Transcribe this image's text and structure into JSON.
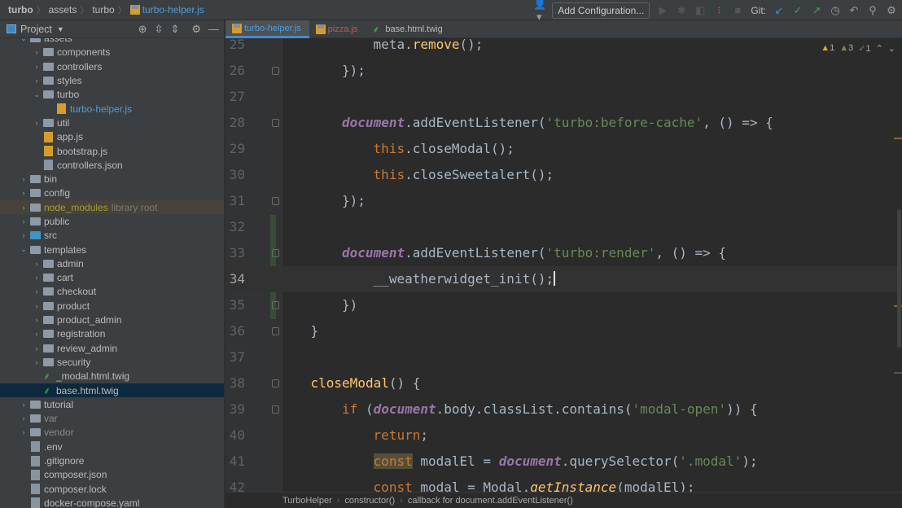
{
  "breadcrumb": [
    "turbo",
    "assets",
    "turbo",
    "turbo-helper.js"
  ],
  "toolbar": {
    "add_configuration": "Add Configuration...",
    "git_label": "Git:"
  },
  "sidebar": {
    "title": "Project",
    "items": [
      {
        "label": "assets",
        "depth": 1,
        "type": "folder",
        "expanded": true
      },
      {
        "label": "components",
        "depth": 2,
        "type": "folder"
      },
      {
        "label": "controllers",
        "depth": 2,
        "type": "folder"
      },
      {
        "label": "styles",
        "depth": 2,
        "type": "folder"
      },
      {
        "label": "turbo",
        "depth": 2,
        "type": "folder",
        "expanded": true
      },
      {
        "label": "turbo-helper.js",
        "depth": 3,
        "type": "js",
        "color": "#4a9ee0"
      },
      {
        "label": "util",
        "depth": 2,
        "type": "folder"
      },
      {
        "label": "app.js",
        "depth": 2,
        "type": "js"
      },
      {
        "label": "bootstrap.js",
        "depth": 2,
        "type": "js"
      },
      {
        "label": "controllers.json",
        "depth": 2,
        "type": "json"
      },
      {
        "label": "bin",
        "depth": 1,
        "type": "folder"
      },
      {
        "label": "config",
        "depth": 1,
        "type": "folder"
      },
      {
        "label": "node_modules",
        "depth": 1,
        "type": "folder",
        "color": "#a2a22e",
        "note": "library root",
        "highlight": true
      },
      {
        "label": "public",
        "depth": 1,
        "type": "folder"
      },
      {
        "label": "src",
        "depth": 1,
        "type": "folder",
        "blue": true
      },
      {
        "label": "templates",
        "depth": 1,
        "type": "folder",
        "expanded": true
      },
      {
        "label": "admin",
        "depth": 2,
        "type": "folder"
      },
      {
        "label": "cart",
        "depth": 2,
        "type": "folder"
      },
      {
        "label": "checkout",
        "depth": 2,
        "type": "folder"
      },
      {
        "label": "product",
        "depth": 2,
        "type": "folder"
      },
      {
        "label": "product_admin",
        "depth": 2,
        "type": "folder"
      },
      {
        "label": "registration",
        "depth": 2,
        "type": "folder"
      },
      {
        "label": "review_admin",
        "depth": 2,
        "type": "folder"
      },
      {
        "label": "security",
        "depth": 2,
        "type": "folder"
      },
      {
        "label": "_modal.html.twig",
        "depth": 2,
        "type": "twig"
      },
      {
        "label": "base.html.twig",
        "depth": 2,
        "type": "twig",
        "selected": true
      },
      {
        "label": "tutorial",
        "depth": 1,
        "type": "folder"
      },
      {
        "label": "var",
        "depth": 1,
        "type": "folder",
        "color": "#8a8a8a"
      },
      {
        "label": "vendor",
        "depth": 1,
        "type": "folder",
        "color": "#8a8a8a"
      },
      {
        "label": ".env",
        "depth": 1,
        "type": "json"
      },
      {
        "label": ".gitignore",
        "depth": 1,
        "type": "json"
      },
      {
        "label": "composer.json",
        "depth": 1,
        "type": "json"
      },
      {
        "label": "composer.lock",
        "depth": 1,
        "type": "json"
      },
      {
        "label": "docker-compose.yaml",
        "depth": 1,
        "type": "json"
      }
    ]
  },
  "tabs": [
    {
      "label": "turbo-helper.js",
      "icon": "js",
      "active": true
    },
    {
      "label": "pizza.js",
      "icon": "js",
      "color": "#c75450"
    },
    {
      "label": "base.html.twig",
      "icon": "twig"
    }
  ],
  "inspections": {
    "warnings": "1",
    "weak_warnings": "3",
    "typos": "1"
  },
  "code": [
    {
      "n": "25",
      "indent": 8,
      "t": [
        [
          "plain",
          "meta."
        ],
        [
          "fn",
          "remove"
        ],
        [
          "plain",
          "();"
        ]
      ]
    },
    {
      "n": "26",
      "indent": 4,
      "fold": true,
      "t": [
        [
          "plain",
          "});"
        ]
      ]
    },
    {
      "n": "27",
      "indent": 0,
      "t": []
    },
    {
      "n": "28",
      "indent": 4,
      "fold": true,
      "t": [
        [
          "doc",
          "document"
        ],
        [
          "plain",
          ".addEventListener("
        ],
        [
          "str",
          "'turbo:before-cache'"
        ],
        [
          "plain",
          ", () => {"
        ]
      ]
    },
    {
      "n": "29",
      "indent": 8,
      "t": [
        [
          "kw",
          "this"
        ],
        [
          "plain",
          ".closeModal();"
        ]
      ]
    },
    {
      "n": "30",
      "indent": 8,
      "t": [
        [
          "kw",
          "this"
        ],
        [
          "plain",
          ".closeSweetalert();"
        ]
      ]
    },
    {
      "n": "31",
      "indent": 4,
      "fold": true,
      "t": [
        [
          "plain",
          "});"
        ]
      ]
    },
    {
      "n": "32",
      "indent": 0,
      "t": []
    },
    {
      "n": "33",
      "indent": 4,
      "fold": true,
      "t": [
        [
          "doc",
          "document"
        ],
        [
          "plain",
          ".addEventListener("
        ],
        [
          "str",
          "'turbo:render'"
        ],
        [
          "plain",
          ", () => {"
        ]
      ]
    },
    {
      "n": "34",
      "indent": 8,
      "current": true,
      "t": [
        [
          "plain",
          "__weatherwidget_init();"
        ]
      ]
    },
    {
      "n": "35",
      "indent": 4,
      "fold": true,
      "t": [
        [
          "plain",
          "})"
        ]
      ]
    },
    {
      "n": "36",
      "indent": 0,
      "fold": true,
      "t": [
        [
          "plain",
          "}"
        ]
      ]
    },
    {
      "n": "37",
      "indent": 0,
      "t": []
    },
    {
      "n": "38",
      "indent": 0,
      "fold": true,
      "t": [
        [
          "fn",
          "closeModal"
        ],
        [
          "plain",
          "() {"
        ]
      ]
    },
    {
      "n": "39",
      "indent": 4,
      "fold": true,
      "t": [
        [
          "kw",
          "if "
        ],
        [
          "plain",
          "("
        ],
        [
          "doc",
          "document"
        ],
        [
          "plain",
          ".body.classList.contains("
        ],
        [
          "str",
          "'modal-open'"
        ],
        [
          "plain",
          ")) {"
        ]
      ]
    },
    {
      "n": "40",
      "indent": 8,
      "t": [
        [
          "kw",
          "return"
        ],
        [
          "plain",
          ";"
        ]
      ]
    },
    {
      "n": "41",
      "indent": 8,
      "t": [
        [
          "kw cb",
          "const"
        ],
        [
          "plain",
          " modalEl = "
        ],
        [
          "doc",
          "document"
        ],
        [
          "plain",
          ".querySelector("
        ],
        [
          "str",
          "'.modal'"
        ],
        [
          "plain",
          ");"
        ]
      ]
    },
    {
      "n": "42",
      "indent": 8,
      "t": [
        [
          "kw",
          "const"
        ],
        [
          "plain",
          " modal = Modal."
        ],
        [
          "it",
          "getInstance"
        ],
        [
          "plain",
          "(modalEl);"
        ]
      ]
    }
  ],
  "status_breadcrumb": [
    "TurboHelper",
    "constructor()",
    "callback for document.addEventListener()"
  ]
}
